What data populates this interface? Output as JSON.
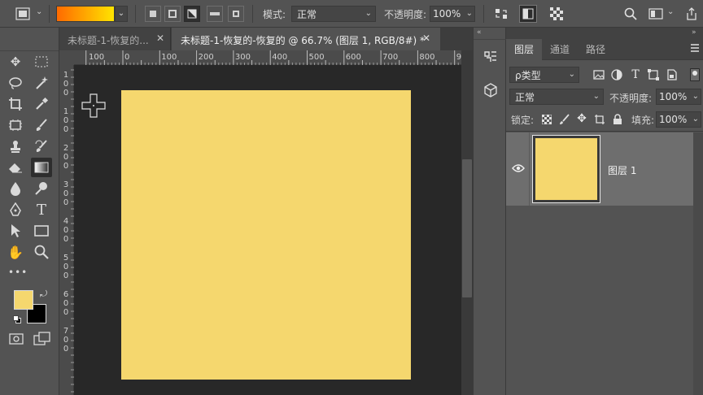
{
  "colors": {
    "foreground": "#f5d76e",
    "background": "#000000",
    "canvas": "#f5d76e",
    "gradient_start": "#ff6a00",
    "gradient_end": "#ffe400"
  },
  "options_bar": {
    "mode_label": "模式:",
    "mode_value": "正常",
    "opacity_label": "不透明度:",
    "opacity_value": "100%"
  },
  "tabs": [
    {
      "label": "未标题-1-恢复的..."
    },
    {
      "label": "未标题-1-恢复的-恢复的 @ 66.7% (图层 1, RGB/8#) *"
    }
  ],
  "ruler": {
    "h_labels": [
      "100",
      "0",
      "100",
      "200",
      "300",
      "400",
      "500",
      "600",
      "700",
      "800",
      "90"
    ],
    "v_labels": [
      "1",
      "0",
      "0",
      "1",
      "0",
      "0",
      "2",
      "0",
      "0",
      "3",
      "0",
      "0",
      "4",
      "0",
      "0",
      "5",
      "0",
      "0",
      "6",
      "0",
      "0",
      "7",
      "0",
      "0"
    ]
  },
  "layers_panel": {
    "tabs": [
      "图层",
      "通道",
      "路径"
    ],
    "filter_label": "ρ类型",
    "blend_mode": "正常",
    "opacity_label": "不透明度:",
    "opacity_value": "100%",
    "lock_label": "锁定:",
    "fill_label": "填充:",
    "fill_value": "100%",
    "layers": [
      {
        "name": "图层 1",
        "visible": true
      }
    ]
  },
  "toolbar": {
    "more_label": "•••"
  }
}
